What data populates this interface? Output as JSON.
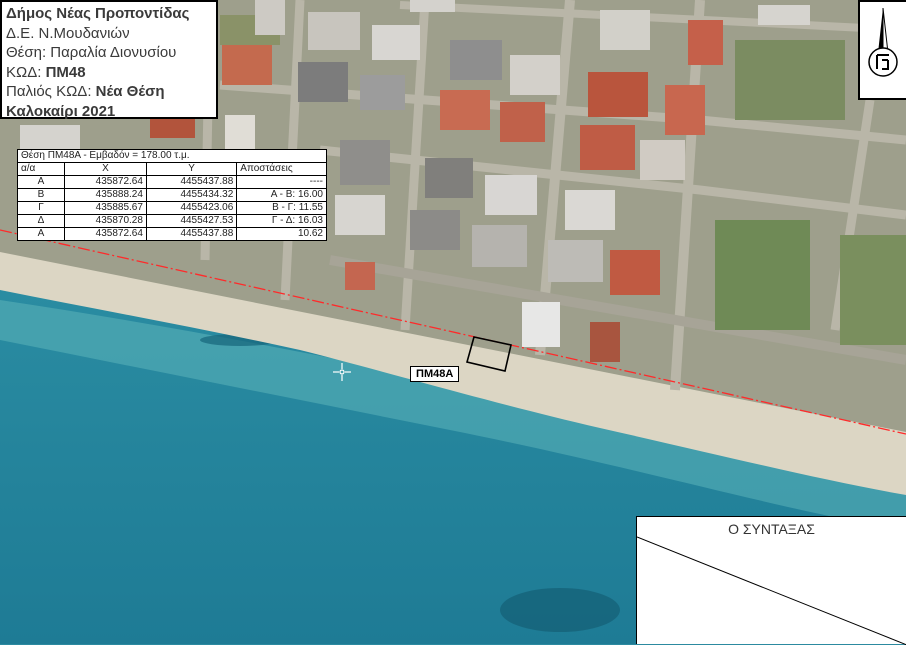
{
  "info": {
    "line1": "Δήμος Νέας Προποντίδας",
    "line2": "Δ.Ε. Ν.Μουδανιών",
    "line3": "Θέση: Παραλία Διονυσίου",
    "line4_prefix": "ΚΩΔ: ",
    "line4_value": "ΠΜ48",
    "line5_prefix": "Παλιός ΚΩΔ: ",
    "line5_value": "Νέα Θέση",
    "line6": "Καλοκαίρι 2021"
  },
  "coord_table": {
    "caption": "Θέση ΠΜ48Α - Εμβαδόν = 178.00 τ.μ.",
    "headers": [
      "α/α",
      "X",
      "Y",
      "Αποστάσεις"
    ],
    "rows": [
      [
        "Α",
        "435872.64",
        "4455437.88",
        "----"
      ],
      [
        "Β",
        "435888.24",
        "4455434.32",
        "Α - Β: 16.00"
      ],
      [
        "Γ",
        "435885.67",
        "4455423.06",
        "Β - Γ: 11.55"
      ],
      [
        "Δ",
        "435870.28",
        "4455427.53",
        "Γ - Δ: 16.03"
      ],
      [
        "Α",
        "435872.64",
        "4455437.88",
        "10.62"
      ]
    ]
  },
  "parcel_label": "ΠΜ48Α",
  "composer": {
    "title": "Ο ΣΥΝΤΑΞΑΣ"
  },
  "north_arrow": {
    "icon": "north-arrow-icon"
  },
  "colors": {
    "sea_deep": "#1f7e97",
    "sea_shallow": "#49a6b1",
    "sand": "#dcd6c4",
    "shoreline": "#ff2a2a",
    "parcel_outline": "#000000"
  }
}
